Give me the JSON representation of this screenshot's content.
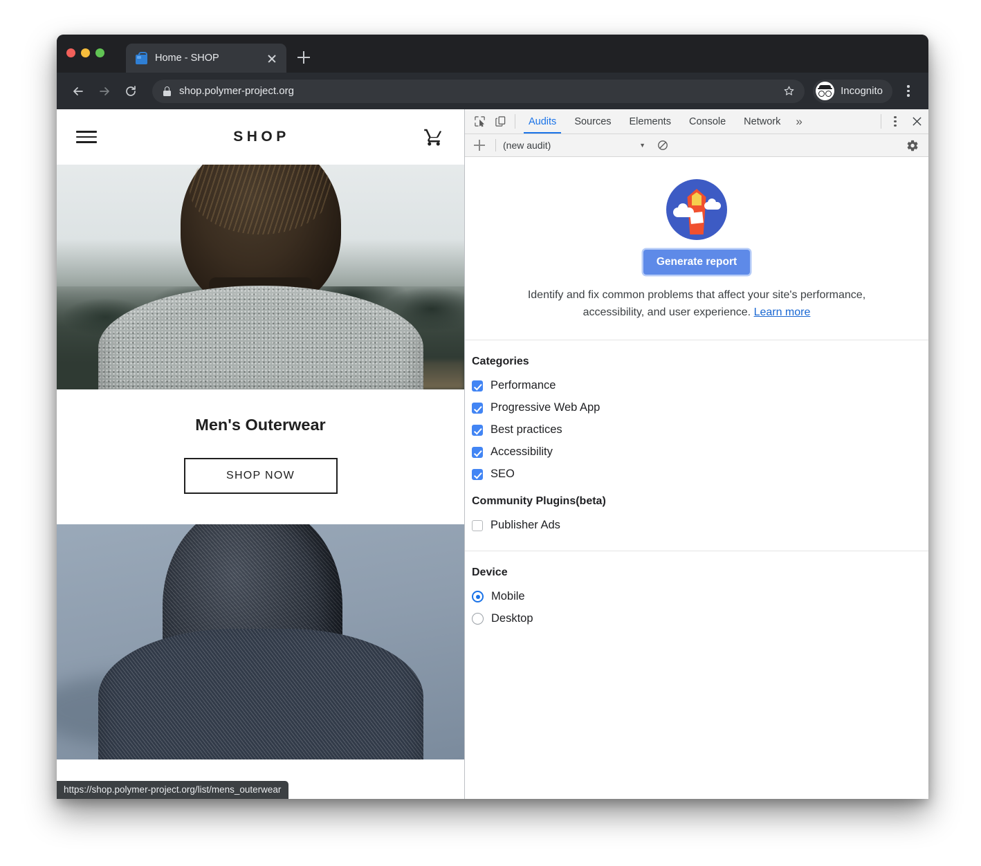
{
  "browser": {
    "tab": {
      "title": "Home - SHOP",
      "favicon": "shopping-bag-icon",
      "close_label": "×"
    },
    "new_tab_label": "+",
    "omnibox": {
      "url": "shop.polymer-project.org",
      "lock": "lock-icon",
      "star": "☆"
    },
    "profile": {
      "label": "Incognito",
      "icon": "incognito-avatar-icon"
    },
    "nav": {
      "back": "←",
      "forward": "→",
      "reload": "⟳"
    },
    "menu_icon": "kebab-menu-icon",
    "status_url": "https://shop.polymer-project.org/list/mens_outerwear"
  },
  "page": {
    "logo": "SHOP",
    "menu_icon": "hamburger-icon",
    "cart_icon": "shopping-cart-icon",
    "promo": {
      "title": "Men's Outerwear",
      "cta": "SHOP NOW"
    },
    "hero_alt": "Man seen from behind wearing a fleece jacket in misty woods",
    "hero2_alt": "Person from behind wearing a dark hooded sweatshirt"
  },
  "devtools": {
    "icons": {
      "inspect": "inspect-element-icon",
      "device": "device-toolbar-icon",
      "more_tabs": "»",
      "kebab": "kebab-menu-icon",
      "close": "×"
    },
    "tabs": [
      {
        "label": "Audits",
        "active": true
      },
      {
        "label": "Sources",
        "active": false
      },
      {
        "label": "Elements",
        "active": false
      },
      {
        "label": "Console",
        "active": false
      },
      {
        "label": "Network",
        "active": false
      }
    ],
    "toolbar": {
      "add_label": "+",
      "select_value": "(new audit)",
      "caret": "▼",
      "clear_icon": "no-entry-clear-icon",
      "settings_icon": "gear-icon"
    },
    "start_view": {
      "logo": "lighthouse-logo-icon",
      "generate_button": "Generate report",
      "description": "Identify and fix common problems that affect your site's performance, accessibility, and user experience.",
      "learn_more": "Learn more"
    },
    "sections": {
      "categories": {
        "title": "Categories",
        "items": [
          {
            "label": "Performance",
            "checked": true
          },
          {
            "label": "Progressive Web App",
            "checked": true
          },
          {
            "label": "Best practices",
            "checked": true
          },
          {
            "label": "Accessibility",
            "checked": true
          },
          {
            "label": "SEO",
            "checked": true
          }
        ]
      },
      "plugins": {
        "title": "Community Plugins(beta)",
        "items": [
          {
            "label": "Publisher Ads",
            "checked": false
          }
        ]
      },
      "device": {
        "title": "Device",
        "options": [
          {
            "label": "Mobile",
            "selected": true
          },
          {
            "label": "Desktop",
            "selected": false
          }
        ]
      }
    }
  },
  "colors": {
    "accent_blue": "#1a73e8",
    "button_blue": "#5e8ae8",
    "checkbox_blue": "#4285f4",
    "lighthouse_circle": "#3d5bc4",
    "lighthouse_tower": "#f0502f",
    "chrome_dark": "#292c31"
  }
}
